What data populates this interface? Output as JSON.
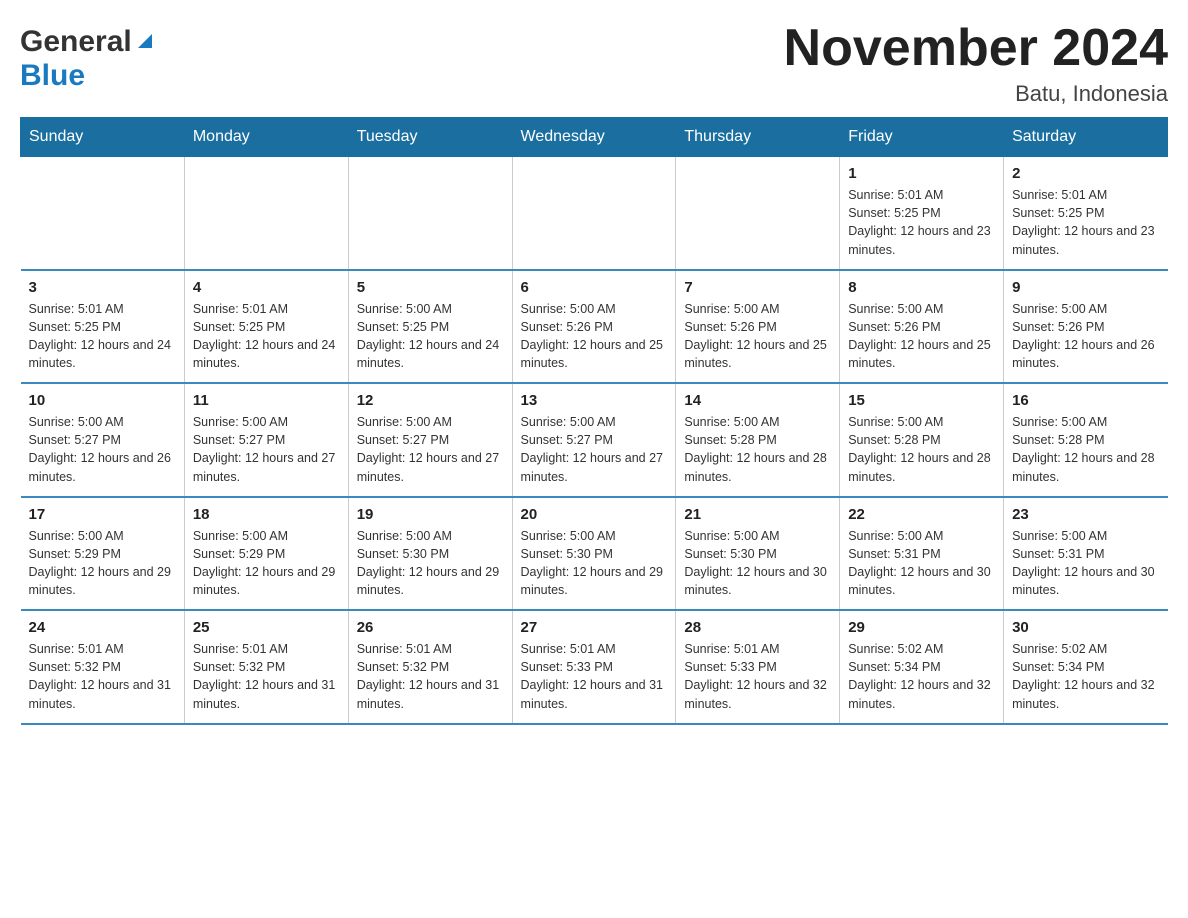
{
  "header": {
    "logo_general": "General",
    "logo_blue": "Blue",
    "title": "November 2024",
    "subtitle": "Batu, Indonesia"
  },
  "days_of_week": [
    "Sunday",
    "Monday",
    "Tuesday",
    "Wednesday",
    "Thursday",
    "Friday",
    "Saturday"
  ],
  "weeks": [
    [
      {
        "day": "",
        "info": ""
      },
      {
        "day": "",
        "info": ""
      },
      {
        "day": "",
        "info": ""
      },
      {
        "day": "",
        "info": ""
      },
      {
        "day": "",
        "info": ""
      },
      {
        "day": "1",
        "info": "Sunrise: 5:01 AM\nSunset: 5:25 PM\nDaylight: 12 hours and 23 minutes."
      },
      {
        "day": "2",
        "info": "Sunrise: 5:01 AM\nSunset: 5:25 PM\nDaylight: 12 hours and 23 minutes."
      }
    ],
    [
      {
        "day": "3",
        "info": "Sunrise: 5:01 AM\nSunset: 5:25 PM\nDaylight: 12 hours and 24 minutes."
      },
      {
        "day": "4",
        "info": "Sunrise: 5:01 AM\nSunset: 5:25 PM\nDaylight: 12 hours and 24 minutes."
      },
      {
        "day": "5",
        "info": "Sunrise: 5:00 AM\nSunset: 5:25 PM\nDaylight: 12 hours and 24 minutes."
      },
      {
        "day": "6",
        "info": "Sunrise: 5:00 AM\nSunset: 5:26 PM\nDaylight: 12 hours and 25 minutes."
      },
      {
        "day": "7",
        "info": "Sunrise: 5:00 AM\nSunset: 5:26 PM\nDaylight: 12 hours and 25 minutes."
      },
      {
        "day": "8",
        "info": "Sunrise: 5:00 AM\nSunset: 5:26 PM\nDaylight: 12 hours and 25 minutes."
      },
      {
        "day": "9",
        "info": "Sunrise: 5:00 AM\nSunset: 5:26 PM\nDaylight: 12 hours and 26 minutes."
      }
    ],
    [
      {
        "day": "10",
        "info": "Sunrise: 5:00 AM\nSunset: 5:27 PM\nDaylight: 12 hours and 26 minutes."
      },
      {
        "day": "11",
        "info": "Sunrise: 5:00 AM\nSunset: 5:27 PM\nDaylight: 12 hours and 27 minutes."
      },
      {
        "day": "12",
        "info": "Sunrise: 5:00 AM\nSunset: 5:27 PM\nDaylight: 12 hours and 27 minutes."
      },
      {
        "day": "13",
        "info": "Sunrise: 5:00 AM\nSunset: 5:27 PM\nDaylight: 12 hours and 27 minutes."
      },
      {
        "day": "14",
        "info": "Sunrise: 5:00 AM\nSunset: 5:28 PM\nDaylight: 12 hours and 28 minutes."
      },
      {
        "day": "15",
        "info": "Sunrise: 5:00 AM\nSunset: 5:28 PM\nDaylight: 12 hours and 28 minutes."
      },
      {
        "day": "16",
        "info": "Sunrise: 5:00 AM\nSunset: 5:28 PM\nDaylight: 12 hours and 28 minutes."
      }
    ],
    [
      {
        "day": "17",
        "info": "Sunrise: 5:00 AM\nSunset: 5:29 PM\nDaylight: 12 hours and 29 minutes."
      },
      {
        "day": "18",
        "info": "Sunrise: 5:00 AM\nSunset: 5:29 PM\nDaylight: 12 hours and 29 minutes."
      },
      {
        "day": "19",
        "info": "Sunrise: 5:00 AM\nSunset: 5:30 PM\nDaylight: 12 hours and 29 minutes."
      },
      {
        "day": "20",
        "info": "Sunrise: 5:00 AM\nSunset: 5:30 PM\nDaylight: 12 hours and 29 minutes."
      },
      {
        "day": "21",
        "info": "Sunrise: 5:00 AM\nSunset: 5:30 PM\nDaylight: 12 hours and 30 minutes."
      },
      {
        "day": "22",
        "info": "Sunrise: 5:00 AM\nSunset: 5:31 PM\nDaylight: 12 hours and 30 minutes."
      },
      {
        "day": "23",
        "info": "Sunrise: 5:00 AM\nSunset: 5:31 PM\nDaylight: 12 hours and 30 minutes."
      }
    ],
    [
      {
        "day": "24",
        "info": "Sunrise: 5:01 AM\nSunset: 5:32 PM\nDaylight: 12 hours and 31 minutes."
      },
      {
        "day": "25",
        "info": "Sunrise: 5:01 AM\nSunset: 5:32 PM\nDaylight: 12 hours and 31 minutes."
      },
      {
        "day": "26",
        "info": "Sunrise: 5:01 AM\nSunset: 5:32 PM\nDaylight: 12 hours and 31 minutes."
      },
      {
        "day": "27",
        "info": "Sunrise: 5:01 AM\nSunset: 5:33 PM\nDaylight: 12 hours and 31 minutes."
      },
      {
        "day": "28",
        "info": "Sunrise: 5:01 AM\nSunset: 5:33 PM\nDaylight: 12 hours and 32 minutes."
      },
      {
        "day": "29",
        "info": "Sunrise: 5:02 AM\nSunset: 5:34 PM\nDaylight: 12 hours and 32 minutes."
      },
      {
        "day": "30",
        "info": "Sunrise: 5:02 AM\nSunset: 5:34 PM\nDaylight: 12 hours and 32 minutes."
      }
    ]
  ]
}
